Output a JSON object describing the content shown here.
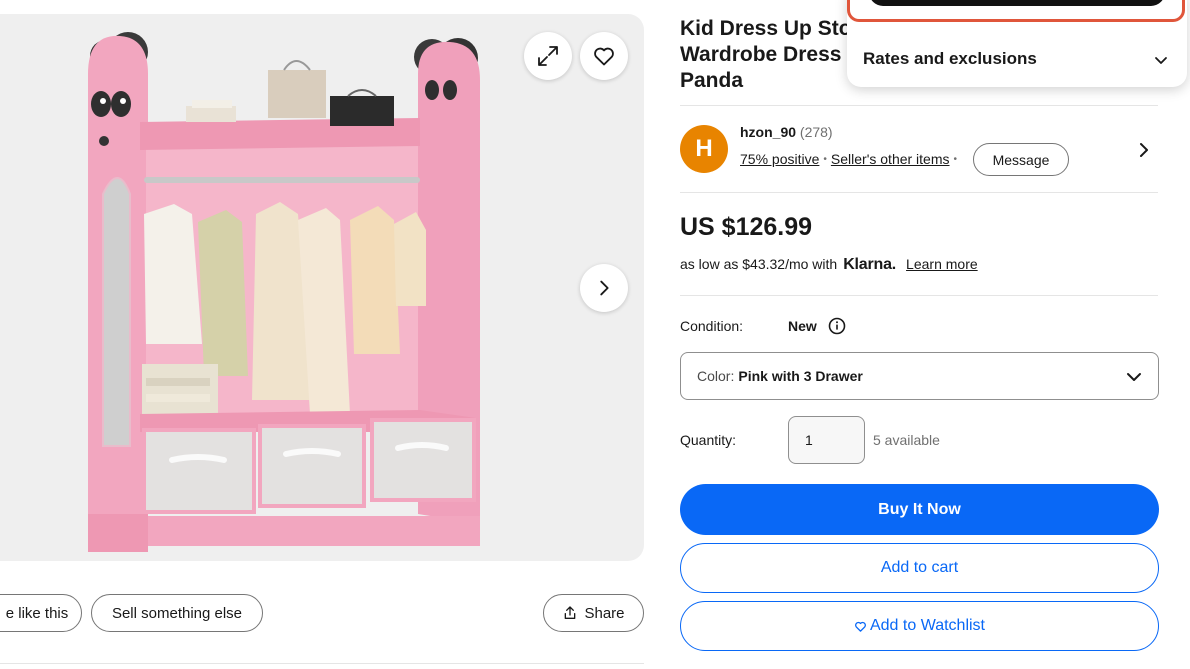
{
  "listing": {
    "title_lines": [
      "Kid Dress Up Storage w/Mirror Kids",
      "Wardrobe Dress",
      "Panda"
    ]
  },
  "gallery": {
    "image_name": "pink-panda-wardrobe-photo",
    "expand_icon": "expand-icon",
    "favorite_icon": "heart-icon",
    "next_icon": "chevron-right-icon"
  },
  "actions": {
    "similar_label": "e like this",
    "sell_label": "Sell something else",
    "share_label": "Share"
  },
  "seller": {
    "initial": "H",
    "name": "hzon_90",
    "feedback_count": "(278)",
    "positive": "75% positive",
    "other_items": "Seller's other items",
    "message": "Message"
  },
  "pricing": {
    "price": "US $126.99",
    "installment": "as low as $43.32/mo with",
    "provider": "Klarna.",
    "learn_more": "Learn more"
  },
  "condition": {
    "label": "Condition:",
    "value": "New"
  },
  "variation": {
    "label": "Color:",
    "value": "Pink with 3 Drawer"
  },
  "quantity": {
    "label": "Quantity:",
    "value": "1",
    "available": "5 available"
  },
  "buttons": {
    "buy": "Buy It Now",
    "cart": "Add to cart",
    "watch": "Add to Watchlist"
  },
  "popover": {
    "title": "Rates and exclusions"
  },
  "colors": {
    "primary_blue": "#0968f6",
    "avatar_orange": "#e88400",
    "wardrobe_pink": "#f2a6bf",
    "popover_outline": "#e0563b"
  }
}
